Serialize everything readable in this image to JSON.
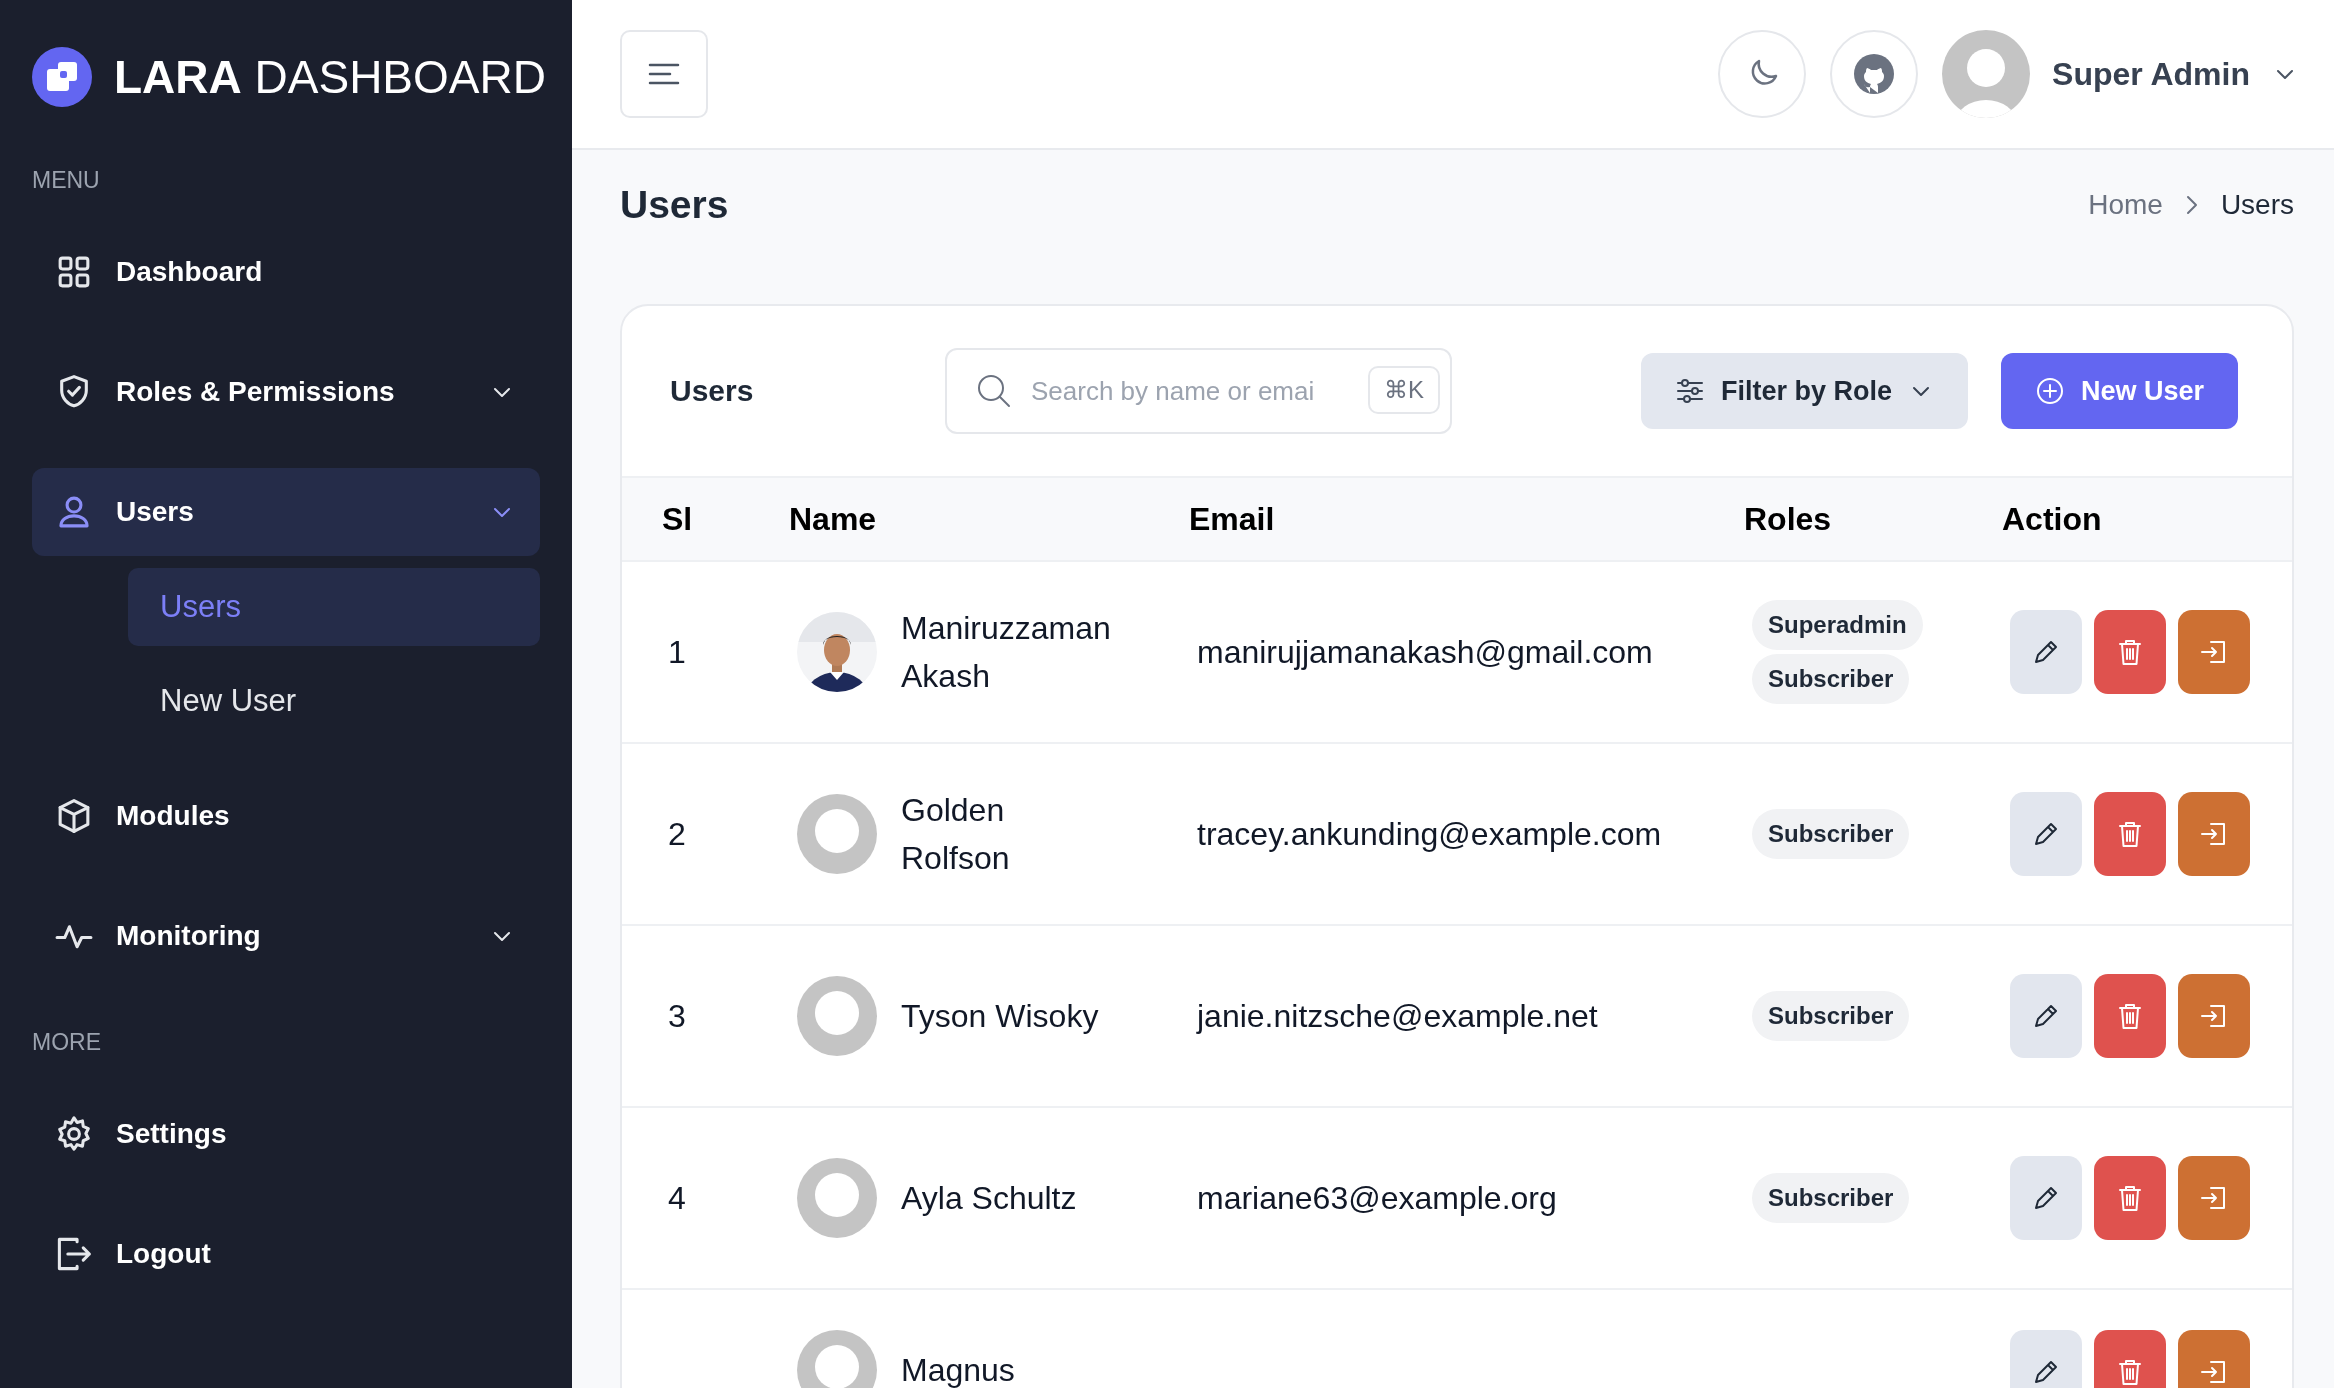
{
  "sidebar": {
    "logo": {
      "bold": "LARA",
      "light": "DASHBOARD"
    },
    "sections": [
      {
        "title": "MENU",
        "items": [
          {
            "label": "Dashboard",
            "selected": false,
            "expandable": false
          },
          {
            "label": "Roles & Permissions",
            "selected": false,
            "expandable": true
          },
          {
            "label": "Users",
            "selected": true,
            "expandable": true,
            "children": [
              {
                "label": "Users",
                "selected": true
              },
              {
                "label": "New User",
                "selected": false
              }
            ]
          },
          {
            "label": "Modules",
            "selected": false,
            "expandable": false
          },
          {
            "label": "Monitoring",
            "selected": false,
            "expandable": true
          }
        ]
      },
      {
        "title": "MORE",
        "items": [
          {
            "label": "Settings",
            "selected": false,
            "expandable": false
          },
          {
            "label": "Logout",
            "selected": false,
            "expandable": false
          }
        ]
      }
    ]
  },
  "header": {
    "user_name": "Super Admin"
  },
  "page": {
    "title": "Users",
    "breadcrumb": [
      {
        "label": "Home"
      },
      {
        "label": "Users"
      }
    ]
  },
  "card": {
    "title": "Users",
    "search": {
      "placeholder": "Search by name or emai",
      "shortcut": "⌘K"
    },
    "filter_button": "Filter by Role",
    "new_button": "New User",
    "table": {
      "columns": [
        "Sl",
        "Name",
        "Email",
        "Roles",
        "Action"
      ],
      "rows": [
        {
          "sl": "1",
          "name": "Maniruzzaman Akash",
          "email": "manirujjamanakash@gmail.com",
          "roles": [
            "Superadmin",
            "Subscriber"
          ]
        },
        {
          "sl": "2",
          "avatar": {
            "kind": "default"
          },
          "name": "Golden Rolfson",
          "email": "tracey.ankunding@example.com",
          "roles": [
            "Subscriber"
          ]
        },
        {
          "sl": "3",
          "avatar": {
            "kind": "default"
          },
          "name": "Tyson Wisoky",
          "email": "janie.nitzsche@example.net",
          "roles": [
            "Subscriber"
          ]
        },
        {
          "sl": "4",
          "avatar": {
            "kind": "default"
          },
          "name": "Ayla Schultz",
          "email": "mariane63@example.org",
          "roles": [
            "Subscriber"
          ]
        },
        {
          "avatar": {
            "kind": "default"
          },
          "name": "Magnus"
        }
      ]
    }
  }
}
